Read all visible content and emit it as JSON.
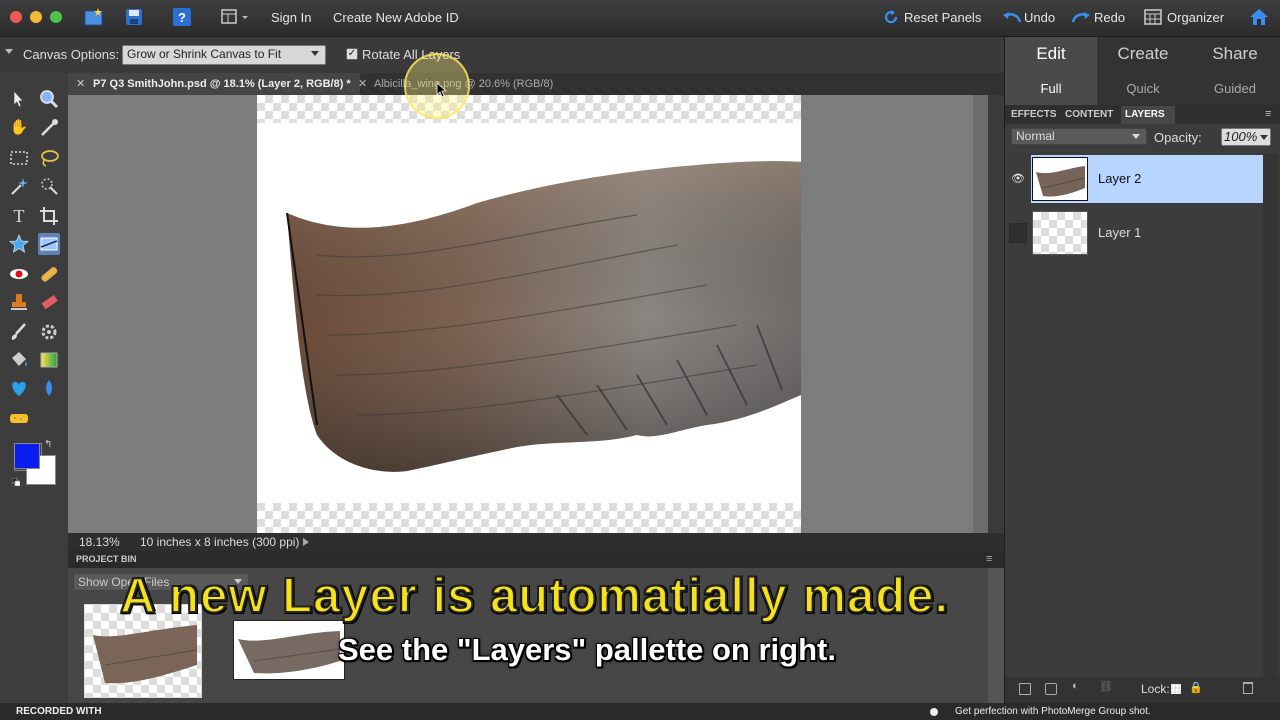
{
  "topbar": {
    "sign_in": "Sign In",
    "create_id": "Create New Adobe ID",
    "reset_panels": "Reset Panels",
    "undo": "Undo",
    "redo": "Redo",
    "organizer": "Organizer",
    "icons": [
      "new-file-icon",
      "save-icon",
      "help-icon",
      "workspace-icon",
      "home-icon"
    ]
  },
  "options": {
    "canvas_options_label": "Canvas Options:",
    "canvas_options_value": "Grow or Shrink Canvas to Fit",
    "rotate_all_layers": "Rotate All Layers",
    "rotate_checked": true
  },
  "tabs": [
    {
      "label": "P7 Q3 SmithJohn.psd @ 18.1% (Layer 2, RGB/8) *",
      "active": true
    },
    {
      "label": "Albicilla_wing.png @ 20.6% (RGB/8)",
      "active": false
    }
  ],
  "status": {
    "zoom": "18.13%",
    "doc_size": "10 inches x 8 inches (300 ppi)"
  },
  "project_bin": {
    "title": "PROJECT BIN",
    "dropdown": "Show Open Files"
  },
  "right_panel": {
    "modes": [
      "Edit",
      "Create",
      "Share"
    ],
    "submodes": [
      "Full",
      "Quick",
      "Guided"
    ],
    "panel_tabs": [
      "EFFECTS",
      "CONTENT",
      "LAYERS"
    ],
    "blend_mode": "Normal",
    "opacity_label": "Opacity:",
    "opacity_value": "100%",
    "layers": [
      {
        "name": "Layer 2",
        "selected": true,
        "visible": true
      },
      {
        "name": "Layer 1",
        "selected": false,
        "visible": false
      }
    ],
    "lock_label": "Lock:"
  },
  "captions": {
    "main": "A new Layer is automatially made.",
    "sub": "See the \"Layers\" pallette on right."
  },
  "bottom": {
    "recorded": "RECORDED WITH",
    "tip": "Get perfection with PhotoMerge Group shot."
  },
  "colors": {
    "accent": "#1e6fd9",
    "foreground_swatch": "#0a1ef0",
    "selected_layer": "#b7d5ff",
    "caption_yellow": "#f5e21c"
  }
}
